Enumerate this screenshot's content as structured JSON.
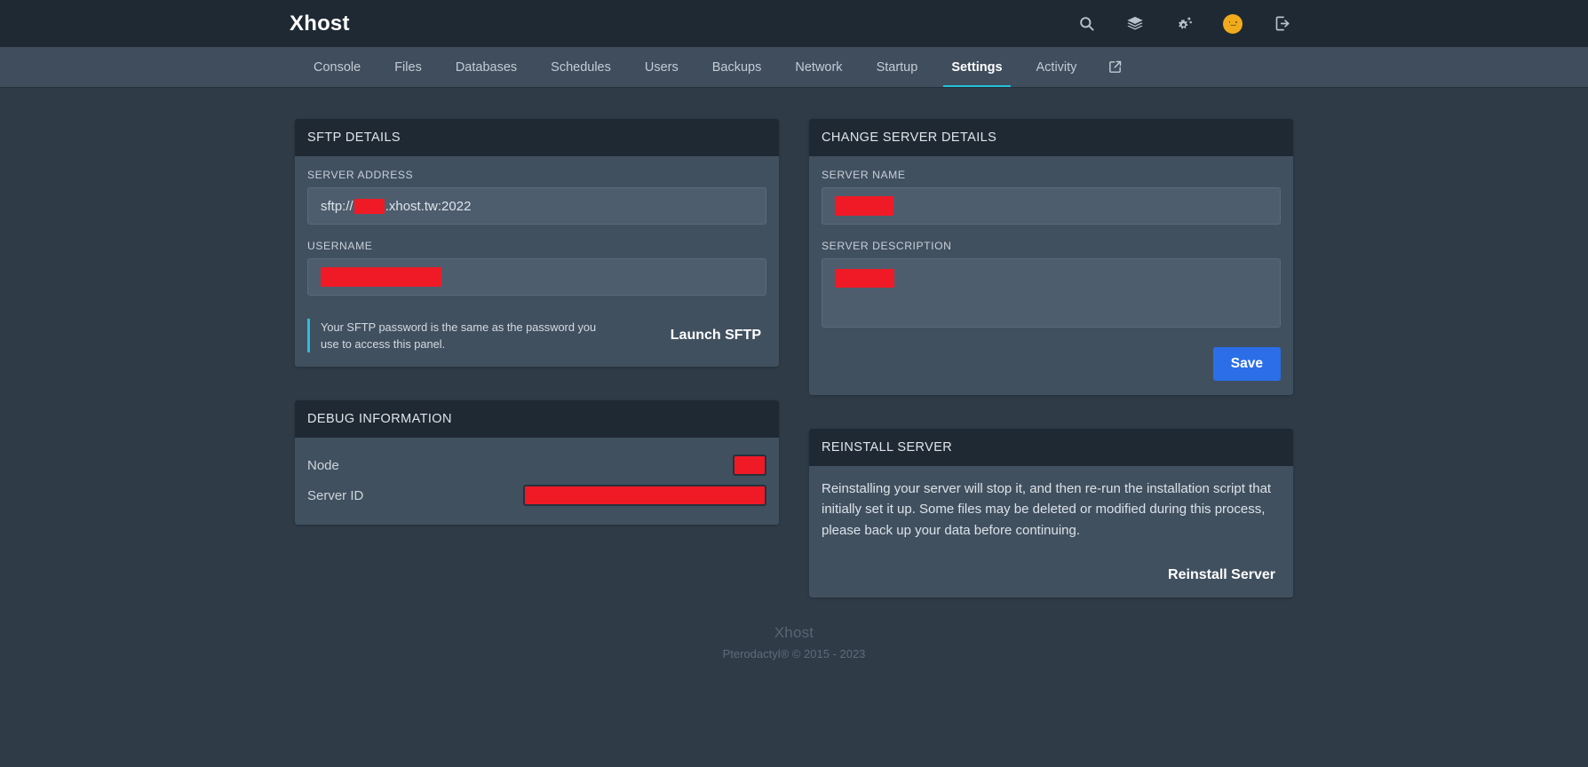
{
  "header": {
    "brand": "Xhost",
    "icons": [
      {
        "name": "search-icon",
        "label": "Search"
      },
      {
        "name": "layers-icon",
        "label": "Servers"
      },
      {
        "name": "cogs-icon",
        "label": "Admin"
      },
      {
        "name": "avatar",
        "label": "Account"
      },
      {
        "name": "logout-icon",
        "label": "Sign out"
      }
    ],
    "avatar_color": "#f0ab1c"
  },
  "nav": {
    "items": [
      {
        "label": "Console",
        "active": false
      },
      {
        "label": "Files",
        "active": false
      },
      {
        "label": "Databases",
        "active": false
      },
      {
        "label": "Schedules",
        "active": false
      },
      {
        "label": "Users",
        "active": false
      },
      {
        "label": "Backups",
        "active": false
      },
      {
        "label": "Network",
        "active": false
      },
      {
        "label": "Startup",
        "active": false
      },
      {
        "label": "Settings",
        "active": true
      },
      {
        "label": "Activity",
        "active": false
      }
    ],
    "external_icon": "external-link-icon",
    "active_underline_color": "#27c0d8"
  },
  "sftp_card": {
    "title": "SFTP DETAILS",
    "server_address_label": "SERVER ADDRESS",
    "server_address_prefix": "sftp://",
    "server_address_suffix": ".xhost.tw:2022",
    "username_label": "USERNAME",
    "username_value": "",
    "note": "Your SFTP password is the same as the password you use to access this panel.",
    "launch_button": "Launch SFTP",
    "note_accent_color": "#27c0d8"
  },
  "debug_card": {
    "title": "DEBUG INFORMATION",
    "rows": [
      {
        "key": "Node",
        "value": ""
      },
      {
        "key": "Server ID",
        "value": ""
      }
    ]
  },
  "change_details_card": {
    "title": "CHANGE SERVER DETAILS",
    "server_name_label": "SERVER NAME",
    "server_name_value": "",
    "server_description_label": "SERVER DESCRIPTION",
    "server_description_value": "",
    "save_label": "Save",
    "save_color": "#2b6ee8"
  },
  "reinstall_card": {
    "title": "REINSTALL SERVER",
    "body": "Reinstalling your server will stop it, and then re-run the installation script that initially set it up. Some files may be deleted or modified during this process, please back up your data before continuing.",
    "button_label": "Reinstall Server"
  },
  "footer": {
    "brand": "Xhost",
    "copyright": "Pterodactyl® © 2015 - 2023"
  }
}
